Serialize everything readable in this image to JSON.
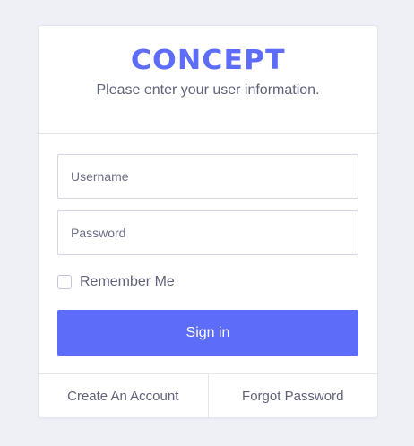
{
  "header": {
    "logo_text": "CONCEPT",
    "subtitle": "Please enter your user information."
  },
  "form": {
    "username_placeholder": "Username",
    "username_value": "",
    "password_placeholder": "Password",
    "password_value": "",
    "remember_label": "Remember Me",
    "remember_checked": false,
    "signin_label": "Sign in"
  },
  "footer": {
    "create_account_label": "Create An Account",
    "forgot_password_label": "Forgot Password"
  },
  "colors": {
    "accent": "#5d6cf9",
    "background": "#eff0f6",
    "text": "#5f6178"
  }
}
